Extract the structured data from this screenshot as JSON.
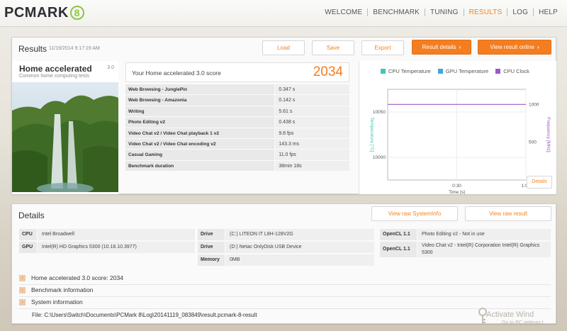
{
  "app": {
    "logo_text": "PCMARK",
    "logo_badge": "8"
  },
  "nav": {
    "items": [
      "WELCOME",
      "BENCHMARK",
      "TUNING",
      "RESULTS",
      "LOG",
      "HELP"
    ],
    "active": "RESULTS"
  },
  "results": {
    "title": "Results",
    "date": "11/19/2014 9:17:19 AM",
    "buttons": {
      "load": "Load",
      "save": "Save",
      "export": "Export",
      "result_details": "Result details",
      "view_online": "View result online"
    },
    "test": {
      "name": "Home accelerated",
      "version": "3.0",
      "subtitle": "Common home computing tests"
    },
    "score_label": "Your Home accelerated 3.0 score",
    "score": "2034",
    "metrics": [
      {
        "name": "Web Browsing - JunglePin",
        "value": "0.347 s"
      },
      {
        "name": "Web Browsing - Amazonia",
        "value": "0.142 s"
      },
      {
        "name": "Writing",
        "value": "5.61 s"
      },
      {
        "name": "Photo Editing v2",
        "value": "0.438 s"
      },
      {
        "name": "Video Chat v2 / Video Chat playback 1 v2",
        "value": "9.8 fps"
      },
      {
        "name": "Video Chat v2 / Video Chat encoding v2",
        "value": "143.3 ms"
      },
      {
        "name": "Casual Gaming",
        "value": "11.0 fps"
      },
      {
        "name": "Benchmark duration",
        "value": "38min 18s"
      }
    ],
    "details_button": "Details"
  },
  "chart_data": {
    "type": "line",
    "legend": [
      {
        "name": "CPU Temperature",
        "color": "#3cc9b4"
      },
      {
        "name": "GPU Temperature",
        "color": "#38a9e0"
      },
      {
        "name": "CPU Clock",
        "color": "#9b59c6"
      }
    ],
    "xlabel": "Time [s]",
    "ylabel_left": "Temperature [°C]",
    "ylabel_right": "Frequency [MHz]",
    "x_ticks": [
      "0:30",
      "1:00"
    ],
    "y_left_ticks": [
      "10050",
      "10000"
    ],
    "y_right_ticks": [
      "1000",
      "500",
      "0"
    ],
    "xlim": [
      0,
      60
    ],
    "ylim_left": [
      9975,
      10075
    ],
    "ylim_right": [
      0,
      1200
    ],
    "series": [
      {
        "name": "CPU Clock",
        "axis": "right",
        "x": [
          0,
          60
        ],
        "values": [
          1000,
          1000
        ]
      }
    ]
  },
  "details": {
    "title": "Details",
    "buttons": {
      "raw_systeminfo": "View raw SystemInfo",
      "raw_result": "View raw result"
    },
    "system": [
      {
        "key": "CPU",
        "value": "Intel Broadwell"
      },
      {
        "key": "GPU",
        "value": "Intel(R) HD Graphics 5300 (10.18.10.3977)"
      }
    ],
    "drives": [
      {
        "key": "Drive",
        "value": "(C:) LITEON IT L8H-128V2G"
      },
      {
        "key": "Drive",
        "value": "(D:) Netac OnlyDisk USB Device"
      },
      {
        "key": "Memory",
        "value": "0MB"
      }
    ],
    "opencl": [
      {
        "key": "OpenCL 1.1",
        "value": "Photo Editing v2 - Not in use"
      },
      {
        "key": "OpenCL 1.1",
        "value": "Video Chat v2 - Intel(R) Corporation Intel(R) Graphics 5300"
      }
    ],
    "sections": [
      {
        "label": "Home accelerated 3.0 score: 2034"
      },
      {
        "label": "Benchmark information"
      },
      {
        "label": "System information"
      }
    ],
    "file_path": "File: C:\\Users\\Switch\\Documents\\PCMark 8\\Log\\20141119_083849\\result.pcmark-8-result"
  },
  "watermark": {
    "title": "Activate Wind",
    "subtitle": "Go to PC settings t"
  }
}
